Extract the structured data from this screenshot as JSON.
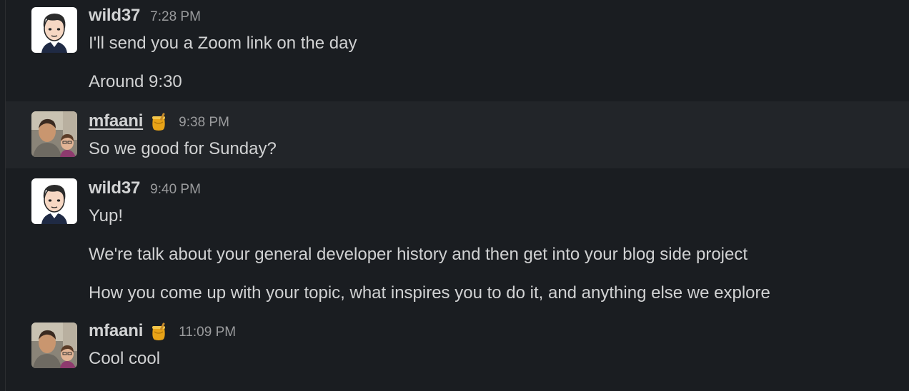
{
  "messages": [
    {
      "sender": "wild37",
      "time": "7:28 PM",
      "lines": [
        "I'll send you a Zoom link on the day",
        "Around 9:30"
      ]
    },
    {
      "sender": "mfaani",
      "time": "9:38 PM",
      "badge_icon": "honey-pot-icon",
      "lines": [
        "So we good for Sunday?"
      ]
    },
    {
      "sender": "wild37",
      "time": "9:40 PM",
      "lines": [
        "Yup!",
        "We're talk about your general developer history and then get into your blog side project",
        "How you come up with your topic, what inspires you to do it, and anything else we explore"
      ]
    },
    {
      "sender": "mfaani",
      "time": "11:09 PM",
      "badge_icon": "honey-pot-icon",
      "lines": [
        "Cool cool"
      ]
    }
  ],
  "colors": {
    "background": "#1a1d21",
    "hover_row": "#222529",
    "text": "#d1d2d3",
    "timestamp": "#9a9b9d"
  }
}
